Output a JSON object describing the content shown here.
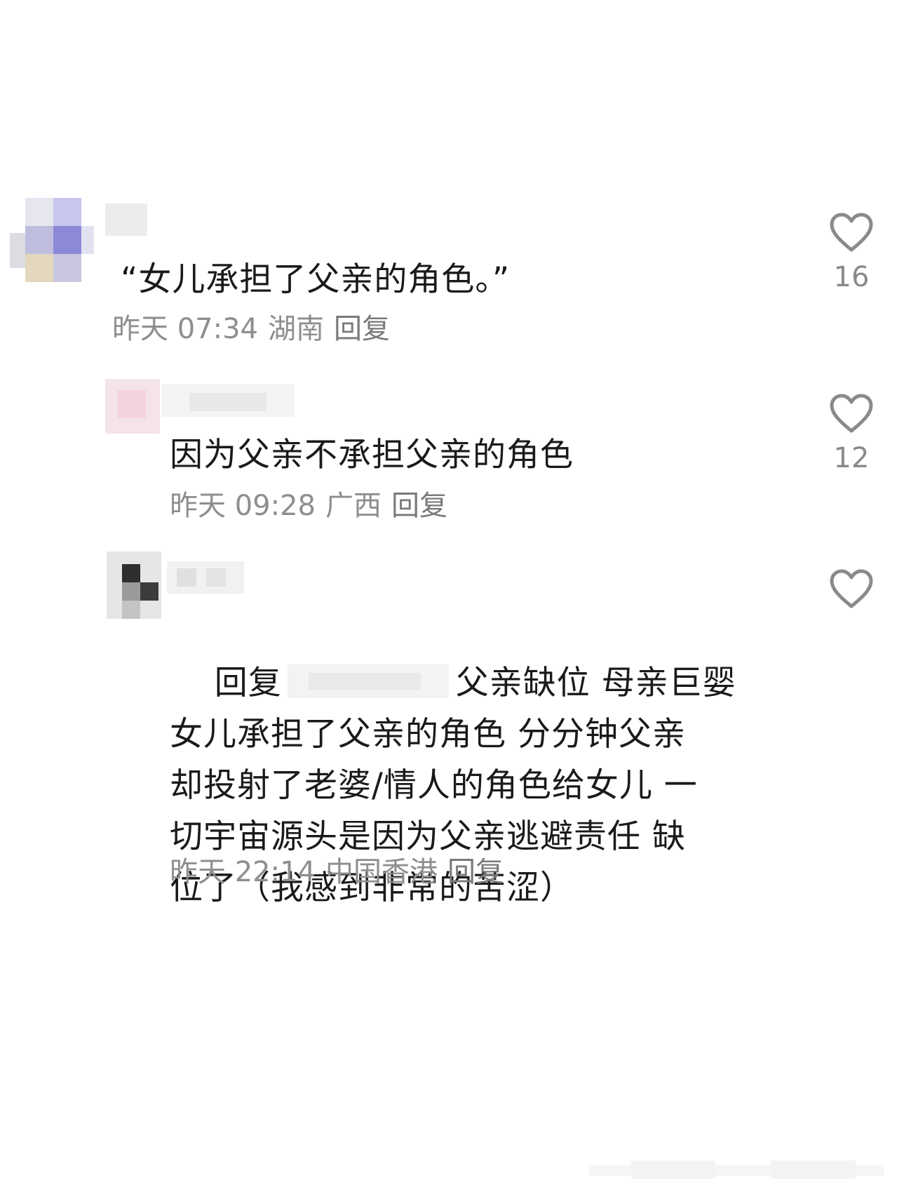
{
  "comments": [
    {
      "text": "“女儿承担了父亲的角色。”",
      "time": "昨天 07:34",
      "location": "湖南",
      "reply_label": "回复",
      "likes": "16"
    },
    {
      "text": "因为父亲不承担父亲的角色",
      "time": "昨天 09:28",
      "location": "广西",
      "reply_label": "回复",
      "likes": "12"
    },
    {
      "reply_prefix": "回复",
      "text_first": "父亲缺位 母亲巨婴",
      "text_rest": "女儿承担了父亲的角色 分分钟父亲\n却投射了老婆/情人的角色给女儿 一\n切宇宙源头是因为父亲逃避责任 缺\n位了（我感到非常的苦涩）",
      "time": "昨天 22:14",
      "location": "中国香港",
      "reply_label": "回复",
      "likes": ""
    }
  ],
  "colors": {
    "text": "#1a1a1a",
    "meta": "#8e8e8e",
    "heart": "#8a8a8a"
  },
  "icons": {
    "like": "heart-outline-icon"
  }
}
